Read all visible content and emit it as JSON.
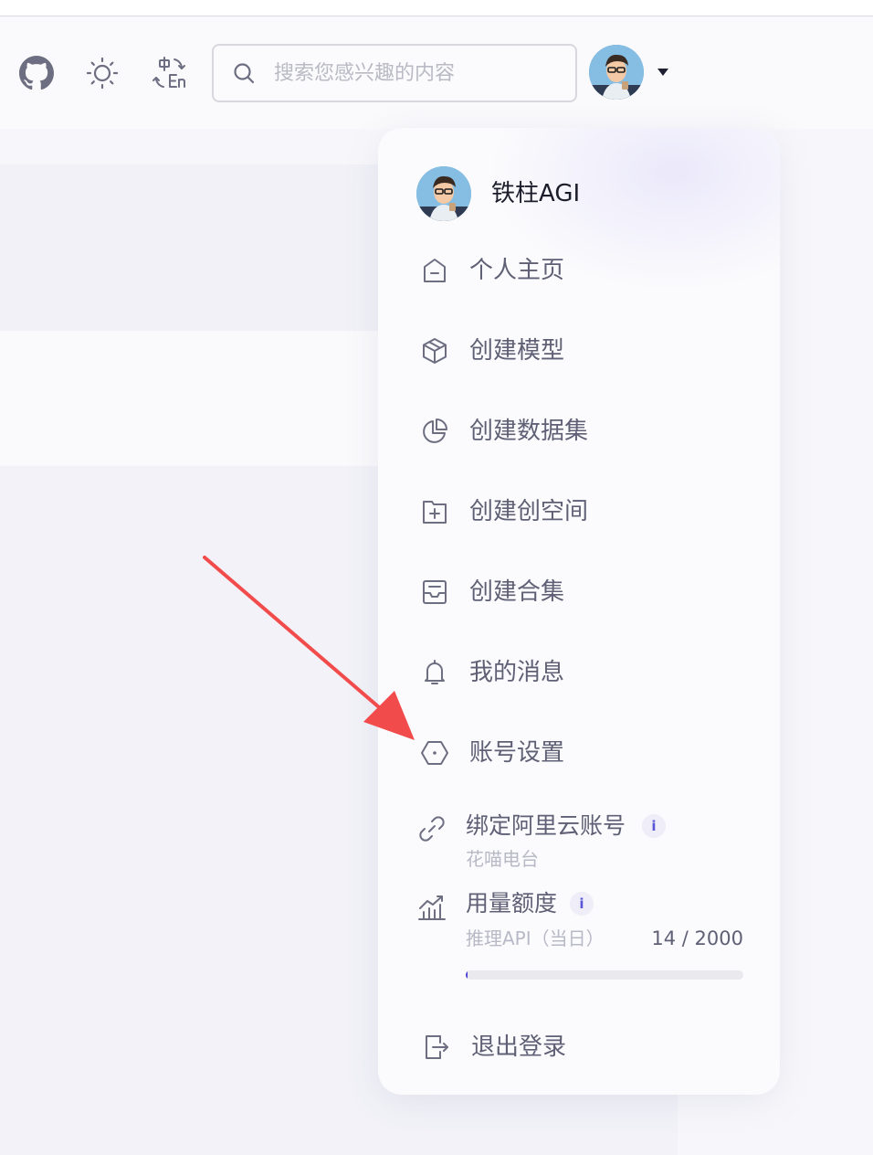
{
  "header": {
    "search_placeholder": "搜索您感兴趣的内容",
    "icons": [
      "github-icon",
      "sun-icon",
      "language-switch-icon"
    ]
  },
  "user_menu": {
    "username": "铁柱AGI",
    "items": [
      {
        "label": "个人主页",
        "icon": "home-icon"
      },
      {
        "label": "创建模型",
        "icon": "cube-icon"
      },
      {
        "label": "创建数据集",
        "icon": "pie-chart-icon"
      },
      {
        "label": "创建创空间",
        "icon": "folder-plus-icon"
      },
      {
        "label": "创建合集",
        "icon": "inbox-icon"
      },
      {
        "label": "我的消息",
        "icon": "bell-icon"
      },
      {
        "label": "账号设置",
        "icon": "settings-hexagon-icon"
      }
    ],
    "aliyun": {
      "title": "绑定阿里云账号",
      "info": "i",
      "account": "花喵电台"
    },
    "usage": {
      "title": "用量额度",
      "info": "i",
      "label": "推理API（当日）",
      "count": "14 / 2000",
      "used": 14,
      "limit": 2000
    },
    "logout": "退出登录"
  },
  "colors": {
    "accent": "#4b3fd8",
    "annotation_arrow": "#f24b4b",
    "menu_text": "#5f6075",
    "icon": "#6d6e82"
  }
}
